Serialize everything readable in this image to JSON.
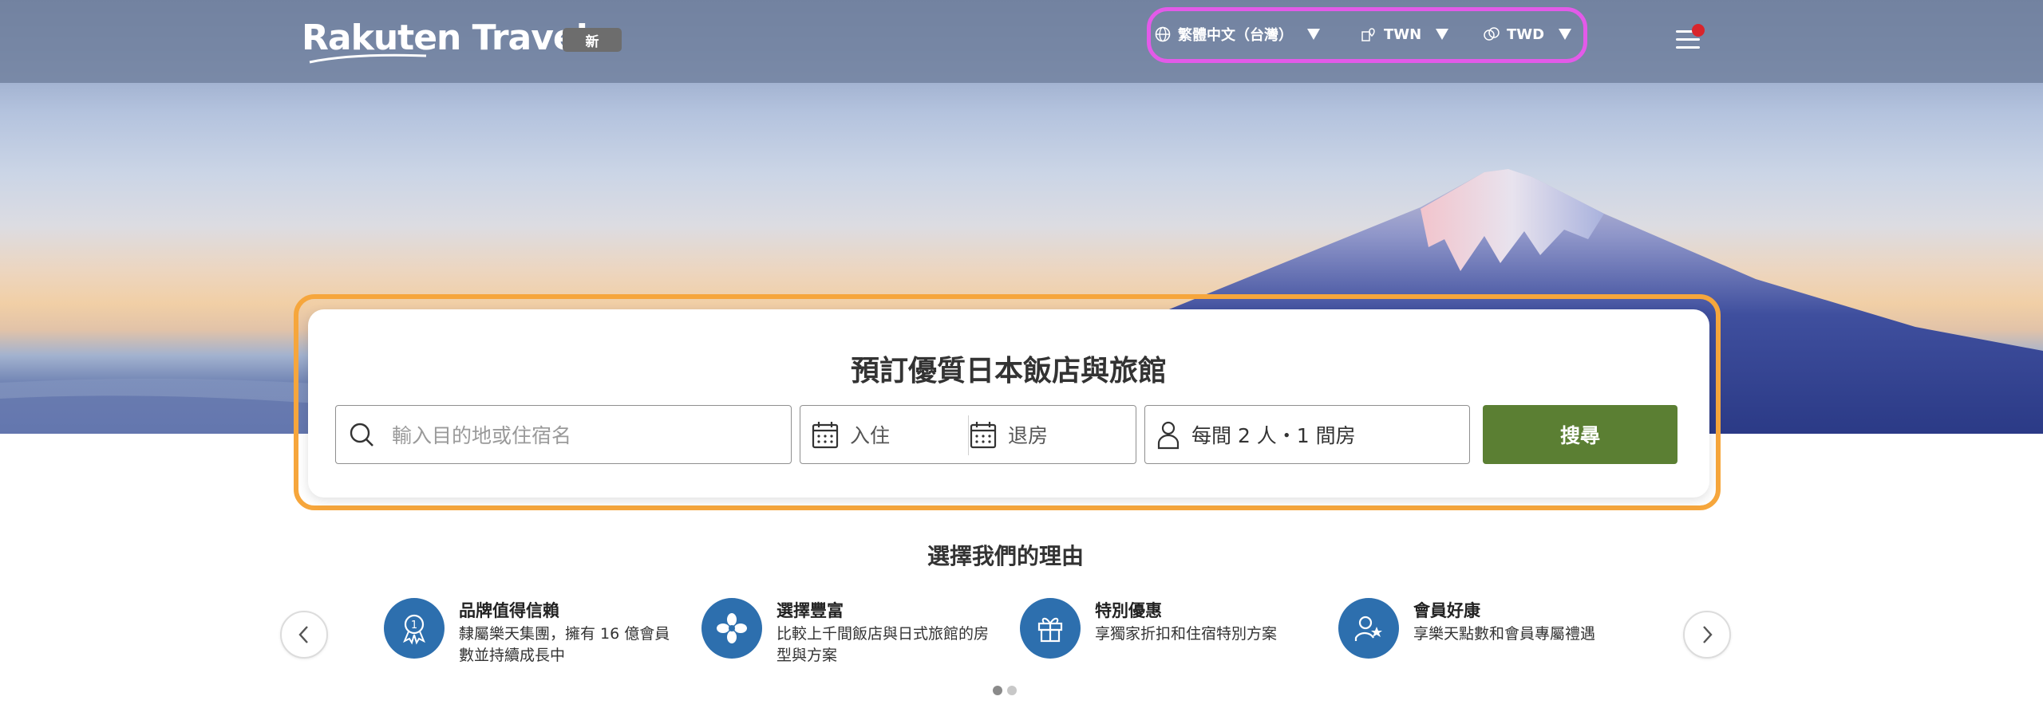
{
  "header": {
    "logo_text": "Rakuten Travel",
    "new_badge": "新",
    "language": {
      "label": "繁體中文（台灣）",
      "icon": "globe-icon"
    },
    "region": {
      "label": "TWN",
      "icon": "location-icon"
    },
    "currency": {
      "label": "TWD",
      "icon": "currency-icon"
    },
    "menu_icon": "hamburger-menu-icon"
  },
  "search": {
    "title": "預訂優質日本飯店與旅館",
    "destination_placeholder": "輸入目的地或住宿名",
    "checkin_label": "入住",
    "checkout_label": "退房",
    "guests_label": "每間 2 人・1 間房",
    "search_button": "搜尋"
  },
  "reasons": {
    "title": "選擇我們的理由",
    "items": [
      {
        "title": "品牌值得信賴",
        "desc": "隸屬樂天集團，擁有 16 億會員數並持續成長中",
        "icon": "award-icon"
      },
      {
        "title": "選擇豐富",
        "desc": "比較上千間飯店與日式旅館的房型與方案",
        "icon": "flower-icon"
      },
      {
        "title": "特別優惠",
        "desc": "享獨家折扣和住宿特別方案",
        "icon": "gift-icon"
      },
      {
        "title": "會員好康",
        "desc": "享樂天點數和會員專屬禮遇",
        "icon": "member-star-icon"
      }
    ]
  },
  "colors": {
    "accent_green": "#5b7f33",
    "icon_blue": "#2d6fae",
    "highlight_pink": "#e35ae9",
    "highlight_orange": "#f6a63c",
    "notification_red": "#d9242b"
  },
  "carousel": {
    "pages": 2,
    "active_page": 1
  }
}
